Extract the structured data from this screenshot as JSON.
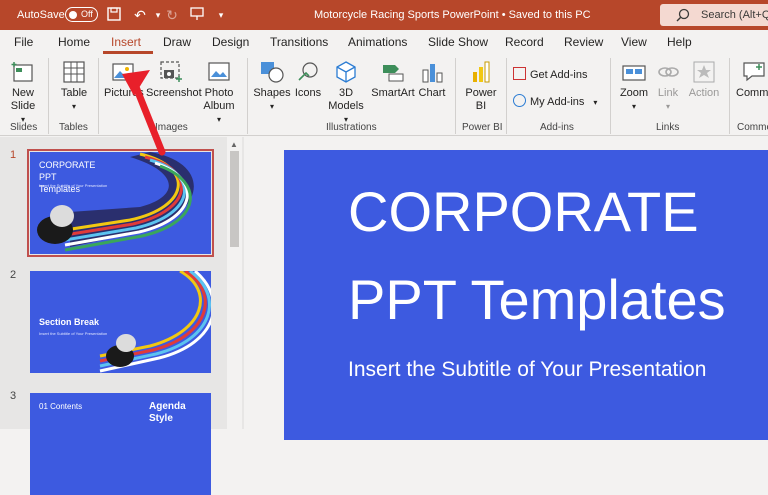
{
  "titlebar": {
    "autosave_label": "AutoSave",
    "autosave_state": "Off",
    "document_title": "Motorcycle Racing Sports PowerPoint • Saved to this PC",
    "search_placeholder": "Search (Alt+Q)",
    "bg_color": "#b7472a"
  },
  "tabs": [
    {
      "label": "File"
    },
    {
      "label": "Home"
    },
    {
      "label": "Insert",
      "active": true
    },
    {
      "label": "Draw"
    },
    {
      "label": "Design"
    },
    {
      "label": "Transitions"
    },
    {
      "label": "Animations"
    },
    {
      "label": "Slide Show"
    },
    {
      "label": "Record"
    },
    {
      "label": "Review"
    },
    {
      "label": "View"
    },
    {
      "label": "Help"
    }
  ],
  "ribbon": {
    "new_slide": "New Slide",
    "table": "Table",
    "pictures": "Pictures",
    "screenshot": "Screenshot",
    "photo_album": "Photo Album",
    "shapes": "Shapes",
    "icons": "Icons",
    "models_3d": "3D Models",
    "smartart": "SmartArt",
    "chart": "Chart",
    "power_bi": "Power BI",
    "get_addins": "Get Add-ins",
    "my_addins": "My Add-ins",
    "zoom": "Zoom",
    "link": "Link",
    "action": "Action",
    "comment": "Comme",
    "groups": {
      "slides": "Slides",
      "tables": "Tables",
      "images": "Images",
      "illustrations": "Illustrations",
      "power_bi": "Power BI",
      "addins": "Add-ins",
      "links": "Links",
      "comments": "Comme"
    }
  },
  "thumbnails": [
    {
      "number": "1",
      "title": "CORPORATE PPT Templates",
      "subtitle": "Insert the Subtitle of Your Presentation",
      "selected": true
    },
    {
      "number": "2",
      "title": "Section Break",
      "subtitle": "Insert the Subtitle of Your Presentation",
      "selected": false
    },
    {
      "number": "3",
      "title": "01 Contents",
      "subtitle": "Agenda Style",
      "selected": false
    }
  ],
  "slide": {
    "title_line1": "CORPORATE",
    "title_line2": "PPT Templates",
    "subtitle": "Insert the Subtitle of Your Presentation",
    "bg_color": "#3d5ae0"
  }
}
